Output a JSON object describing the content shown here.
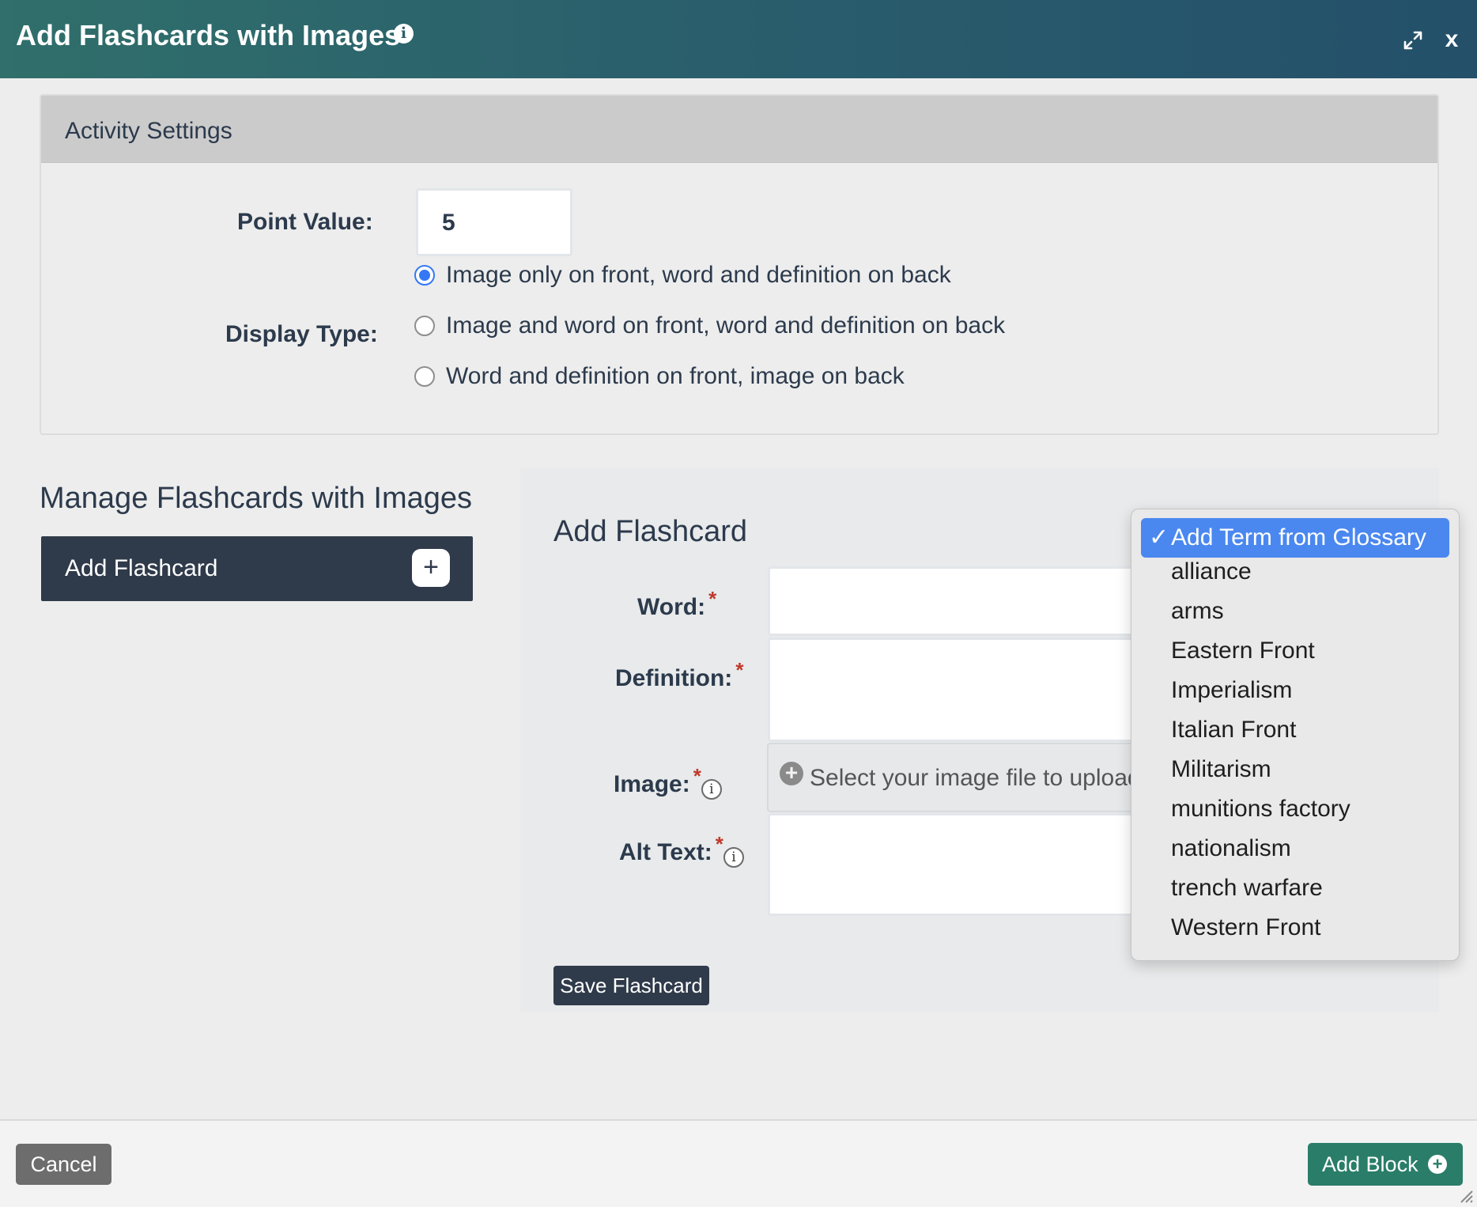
{
  "header": {
    "title": "Add Flashcards with Images",
    "close_label": "x"
  },
  "settings": {
    "heading": "Activity Settings",
    "point_value_label": "Point Value:",
    "point_value": "5",
    "display_type_label": "Display Type:",
    "display_options": [
      {
        "label": "Image only on front, word and definition on back",
        "selected": true
      },
      {
        "label": "Image and word on front, word and definition on back",
        "selected": false
      },
      {
        "label": "Word and definition on front, image on back",
        "selected": false
      }
    ]
  },
  "manage": {
    "title": "Manage Flashcards with Images",
    "add_button": "Add Flashcard"
  },
  "form": {
    "title": "Add Flashcard",
    "word_label": "Word:",
    "definition_label": "Definition:",
    "image_label": "Image:",
    "image_placeholder": "Select your image file to upload",
    "alt_text_label": "Alt Text:",
    "required_mark": "*",
    "info_glyph": "i",
    "save_button": "Save Flashcard"
  },
  "glossary_dropdown": {
    "selected": "Add Term from Glossary",
    "items": [
      "alliance",
      "arms",
      "Eastern Front",
      "Imperialism",
      "Italian Front",
      "Militarism",
      "munitions factory",
      "nationalism",
      "trench warfare",
      "Western Front"
    ]
  },
  "footer": {
    "cancel": "Cancel",
    "add_block": "Add Block"
  },
  "colors": {
    "header_start": "#306f6b",
    "header_end": "#24506a",
    "dark_button": "#2f3a4a",
    "accent_green": "#2a7d68",
    "radio_blue": "#3478f6",
    "required_red": "#c0392b"
  },
  "icons": [
    "info-icon",
    "expand-icon",
    "close-icon",
    "plus-icon",
    "upload-plus-icon",
    "checkmark-icon",
    "add-block-plus-icon",
    "resize-grip-icon"
  ]
}
